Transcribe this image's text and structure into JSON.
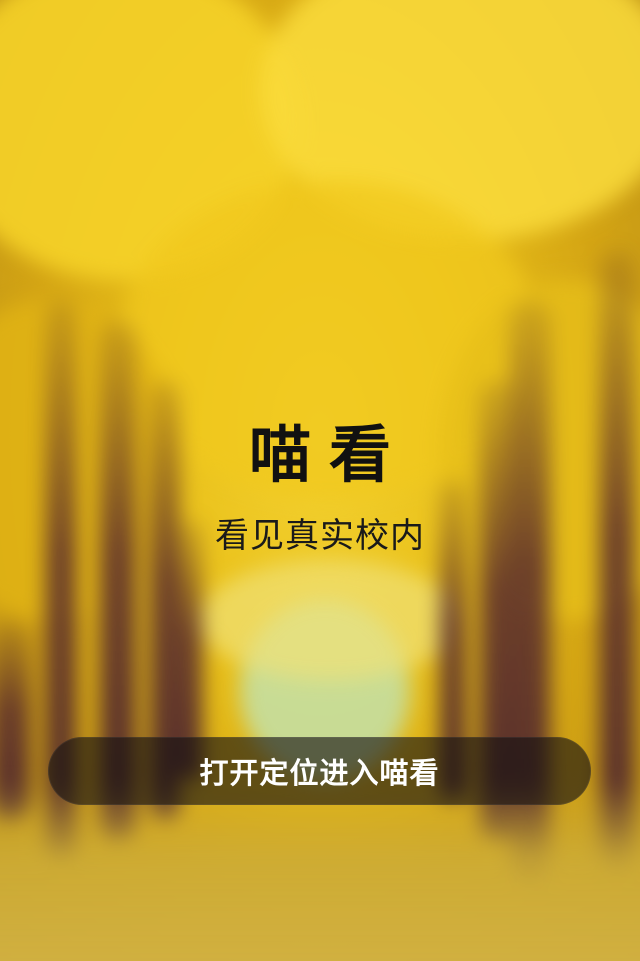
{
  "app": {
    "title": "喵看",
    "tagline": "看见真实校内"
  },
  "actions": {
    "enable_location_label": "打开定位进入喵看"
  },
  "colors": {
    "foliage": "#e9c019",
    "trunk": "#5c2e2c",
    "button_bg": "rgba(20,16,18,0.62)",
    "title_text": "#111111",
    "button_text": "#ffffff"
  }
}
